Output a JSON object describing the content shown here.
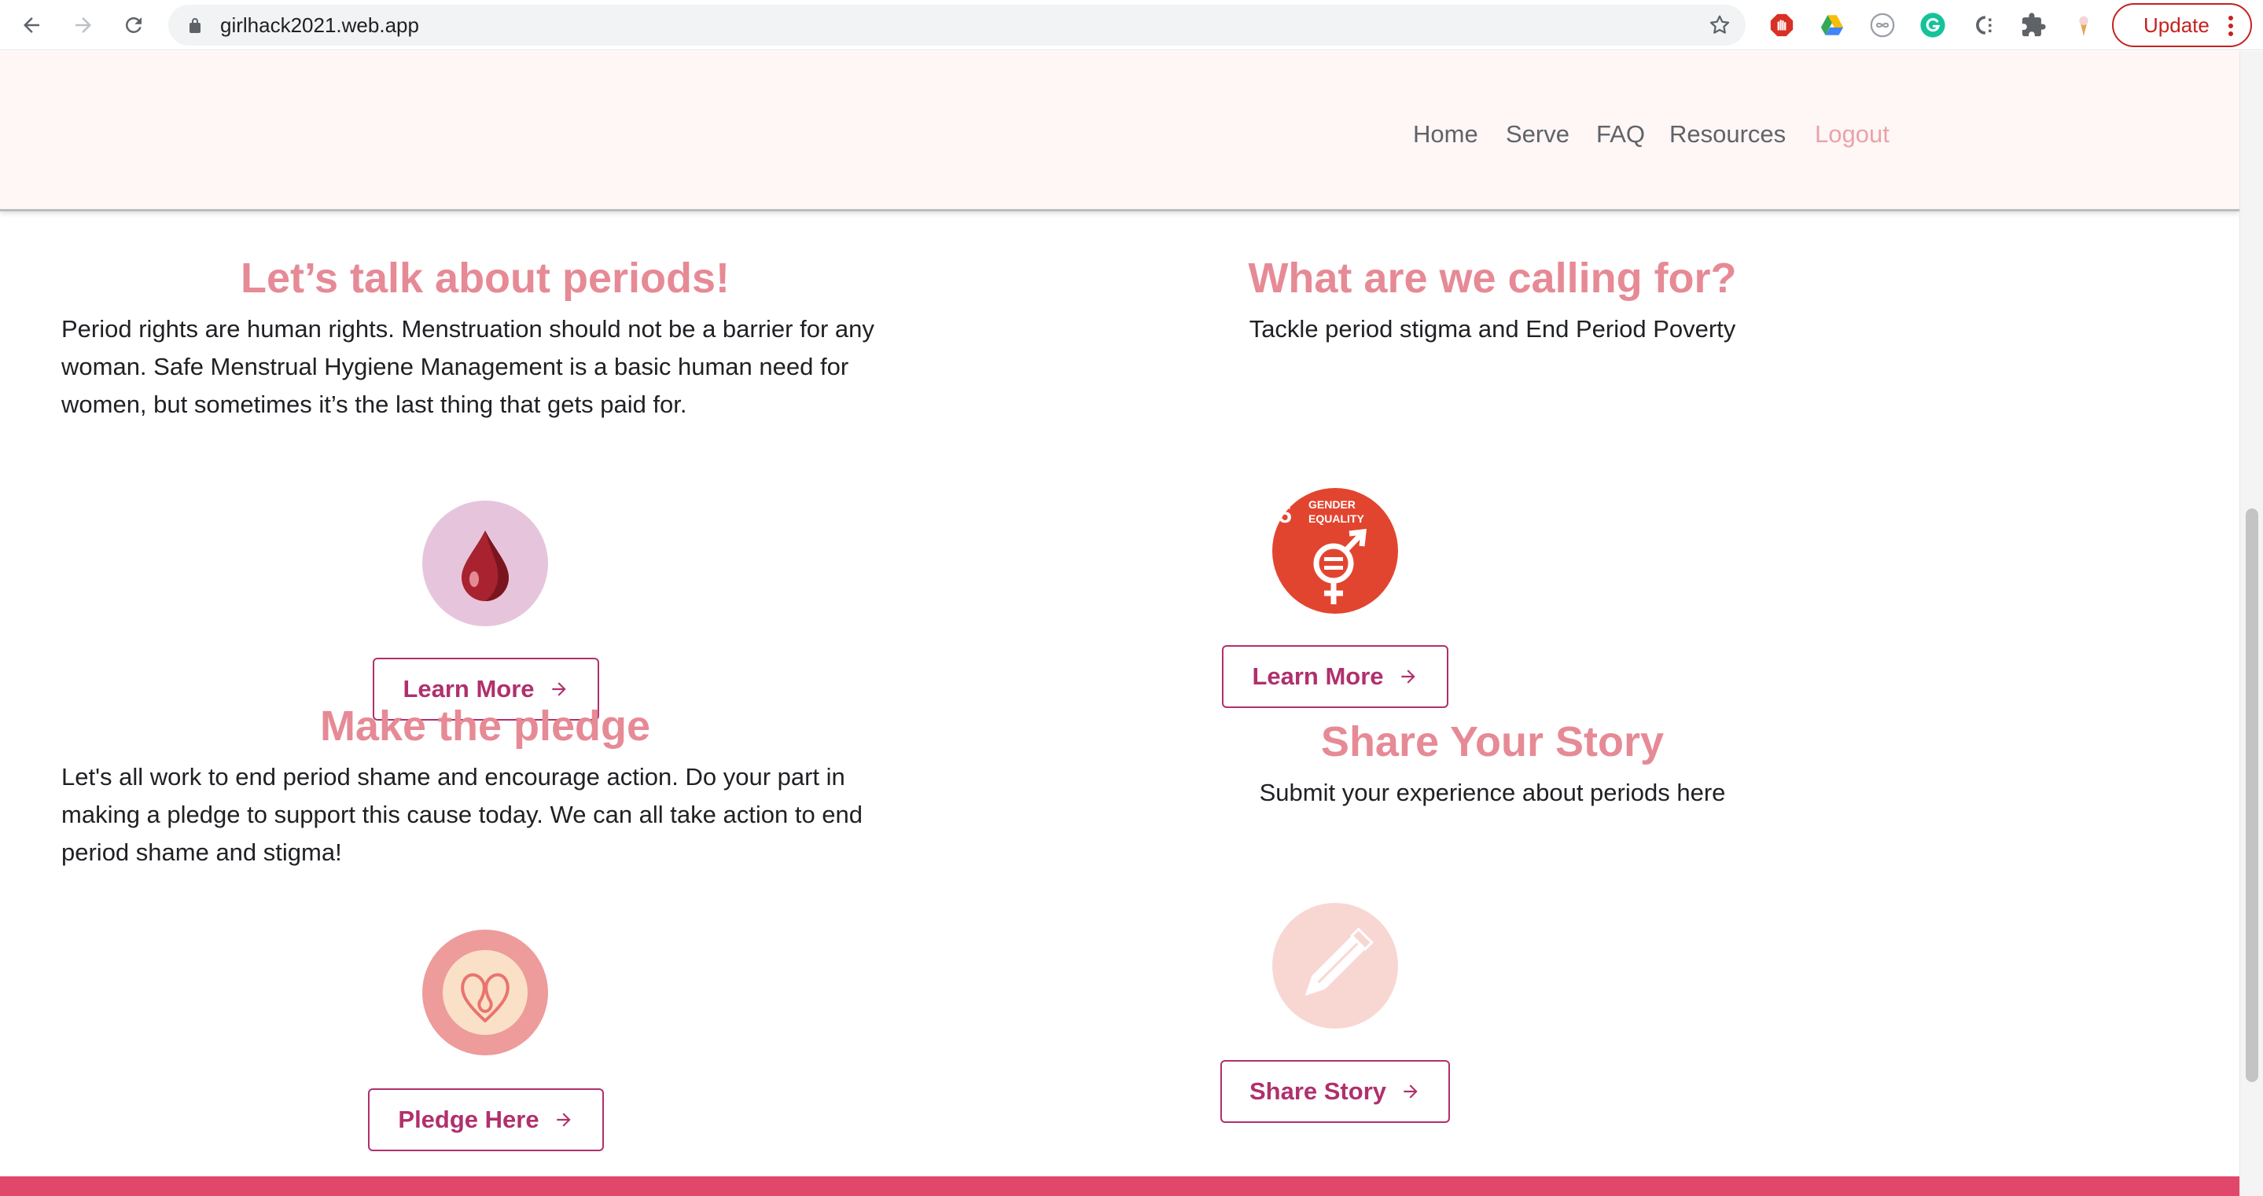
{
  "browser": {
    "url": "girlhack2021.web.app",
    "update_label": "Update"
  },
  "nav": {
    "home": "Home",
    "serve": "Serve",
    "faq": "FAQ",
    "resources": "Resources",
    "logout": "Logout"
  },
  "periods": {
    "title": "Let’s talk about periods!",
    "text": "Period rights are human rights. Menstruation should not be a barrier for any woman. Safe Menstrual Hygiene Management is a basic human need for women, but sometimes it’s the last thing that gets paid for.",
    "button": "Learn More",
    "icon": "blood-drop-icon"
  },
  "calling": {
    "title": "What are we calling for?",
    "text": "Tackle period stigma and End Period Poverty",
    "button": "Learn More",
    "sdg_number": "5",
    "sdg_label_line1": "GENDER",
    "sdg_label_line2": "EQUALITY",
    "icon": "gender-equality-icon"
  },
  "pledge": {
    "title": "Make the pledge",
    "text": "Let's all work to end period shame and encourage action. Do your part in making a pledge to support this cause today. We can all take action to end period shame and stigma!",
    "button": "Pledge Here",
    "icon": "heart-icon"
  },
  "story": {
    "title": "Share Your Story",
    "text": "Submit your experience about periods here",
    "button": "Share Story",
    "icon": "pencil-icon"
  },
  "colors": {
    "heading": "#e68a96",
    "button_border": "#b0306c",
    "header_bg": "#fff6f6",
    "footer_band": "#e0476a",
    "logout": "#e8a3a8"
  }
}
